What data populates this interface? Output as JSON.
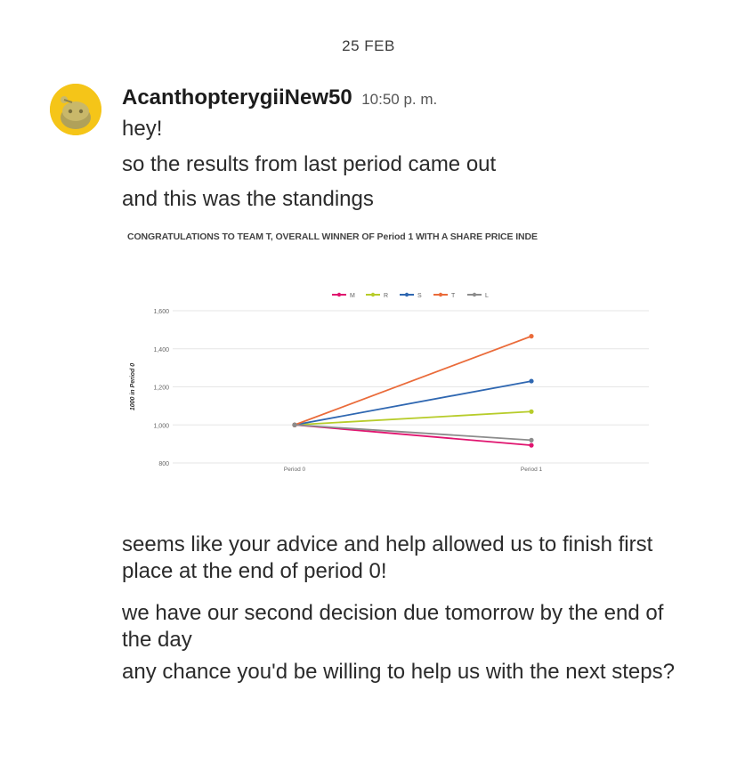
{
  "date_divider": "25 FEB",
  "message": {
    "username": "AcanthopterygiiNew50",
    "time": "10:50 p. m.",
    "lines_before_image": [
      "hey!",
      "so the results from last period came out",
      "and this was the standings"
    ],
    "lines_after_image": [
      "seems like your advice and help allowed us to finish first place at the end of period 0!",
      "we have our second decision due tomorrow by the end of the day",
      "any chance you'd be willing to help us with the next steps?"
    ]
  },
  "chart_data": {
    "type": "line",
    "title": "CONGRATULATIONS TO TEAM T, OVERALL WINNER OF Period 1 WITH A SHARE PRICE INDE",
    "ylabel": "1000 in Period 0",
    "xlabel": "",
    "x": [
      "Period 0",
      "Period 1"
    ],
    "ylim": [
      800,
      1600
    ],
    "yticks": [
      "800",
      "1,000",
      "1,200",
      "1,400",
      "1,600"
    ],
    "grid": true,
    "legend_position": "top",
    "series": [
      {
        "name": "M",
        "color": "#e0146f",
        "values": [
          1000,
          893
        ]
      },
      {
        "name": "R",
        "color": "#b7cc2a",
        "values": [
          1000,
          1070
        ]
      },
      {
        "name": "S",
        "color": "#2f67b1",
        "values": [
          1000,
          1230
        ]
      },
      {
        "name": "T",
        "color": "#ea6b3a",
        "values": [
          1000,
          1466
        ]
      },
      {
        "name": "L",
        "color": "#8c8c8c",
        "values": [
          1000,
          920
        ]
      }
    ]
  }
}
